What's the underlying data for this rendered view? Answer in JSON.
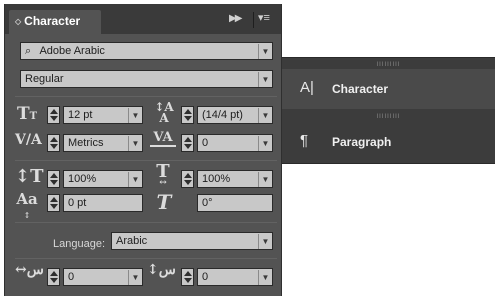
{
  "panel": {
    "tab_label": "Character",
    "font_family": "Adobe Arabic",
    "font_style": "Regular",
    "font_size": "12 pt",
    "leading": "(14/4 pt)",
    "kerning": "Metrics",
    "tracking": "0",
    "vertical_scale": "100%",
    "horizontal_scale": "100%",
    "baseline_shift": "0 pt",
    "skew": "0°",
    "language_label": "Language:",
    "language": "Arabic",
    "diacritic_x": "0",
    "diacritic_y": "0"
  },
  "side_panel": {
    "items": [
      {
        "label": "Character",
        "icon": "A|"
      },
      {
        "label": "Paragraph",
        "icon": "¶"
      }
    ],
    "grip": "IIIIIIIII"
  }
}
